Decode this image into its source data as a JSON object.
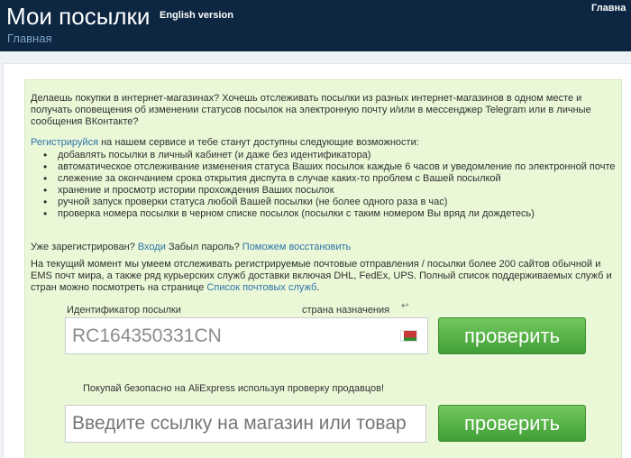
{
  "header": {
    "title": "Мои посылки",
    "english_link": "English version",
    "top_right": "Главна",
    "breadcrumb": "Главная"
  },
  "intro": "Делаешь покупки в интернет-магазинах? Хочешь отслеживать посылки из разных интернет-магазинов в одном месте и получать оповещения об изменении статусов посылок на электронную почту и/или в мессенджер Telegram или в личные сообщения ВКонтакте?",
  "features": {
    "register_link": "Регистрируйся",
    "lead": "на нашем сервисе и тебе станут доступны следующие возможности:",
    "items": [
      "добавлять посылки в личный кабинет (и даже без идентификатора)",
      "автоматическое отслеживание изменения статуса Ваших посылок каждые 6 часов и уведомление по электронной почте",
      "слежение за окончанием срока открытия диспута в случае каких-то проблем с Вашей посылкой",
      "хранение и просмотр истории прохождения Ваших посылок",
      "ручной запуск проверки статуса любой Вашей посылки (не более одного раза в час)",
      "проверка номера посылки в черном списке посылок (посылки с таким номером Вы вряд ли дождетесь)"
    ]
  },
  "login": {
    "question": "Уже зарегистрирован?",
    "login_link": "Входи",
    "forgot": "Забыл пароль?",
    "recover_link": "Поможем восстановить"
  },
  "summary": {
    "text": "На текущий момент мы умеем отслеживать регистрируемые почтовые отправления / посылки более 200 сайтов обычной и EMS почт мира, а также ряд курьерских служб доставки включая DHL, FedEx, UPS. Полный список поддерживаемых служб и стран можно посмотреть на странице",
    "link": "Список почтовых служб",
    "end": "."
  },
  "tracking": {
    "label": "Идентификатор посылки",
    "destination_label": "страна назначения",
    "value": "RC164350331CN",
    "button": "проверить",
    "flag_icon": "belarus-flag-icon",
    "return_icon": "return-arrow-icon"
  },
  "aliexpress": {
    "note": "Покупай безопасно на AliExpress используя проверку продавцов!",
    "placeholder": "Введите ссылку на магазин или товар",
    "button": "проверить"
  }
}
